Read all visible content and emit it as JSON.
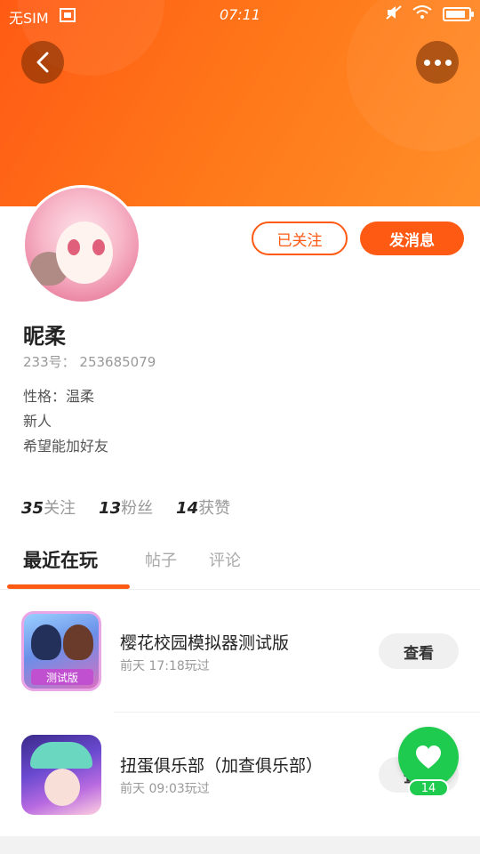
{
  "status_bar": {
    "sim": "无SIM",
    "time": "07:11"
  },
  "profile": {
    "follow_button": "已关注",
    "message_button": "发消息",
    "name": "昵柔",
    "id_line": "233号： 253685079",
    "bio_lines": [
      "性格：温柔",
      "新人",
      "希望能加好友"
    ]
  },
  "stats": [
    {
      "num": "35",
      "label": "关注"
    },
    {
      "num": "13",
      "label": "粉丝"
    },
    {
      "num": "14",
      "label": "获赞"
    }
  ],
  "tabs": [
    "最近在玩",
    "帖子",
    "评论"
  ],
  "games": [
    {
      "title": "樱花校园模拟器测试版",
      "meta": "前天 17:18玩过",
      "button": "查看",
      "badge": "测试版"
    },
    {
      "title": "扭蛋俱乐部（加查俱乐部）",
      "meta": "前天 09:03玩过",
      "button": "查看"
    }
  ],
  "fab": {
    "count": "14"
  },
  "colors": {
    "accent": "#ff5a14",
    "fab": "#1ecb4f"
  }
}
